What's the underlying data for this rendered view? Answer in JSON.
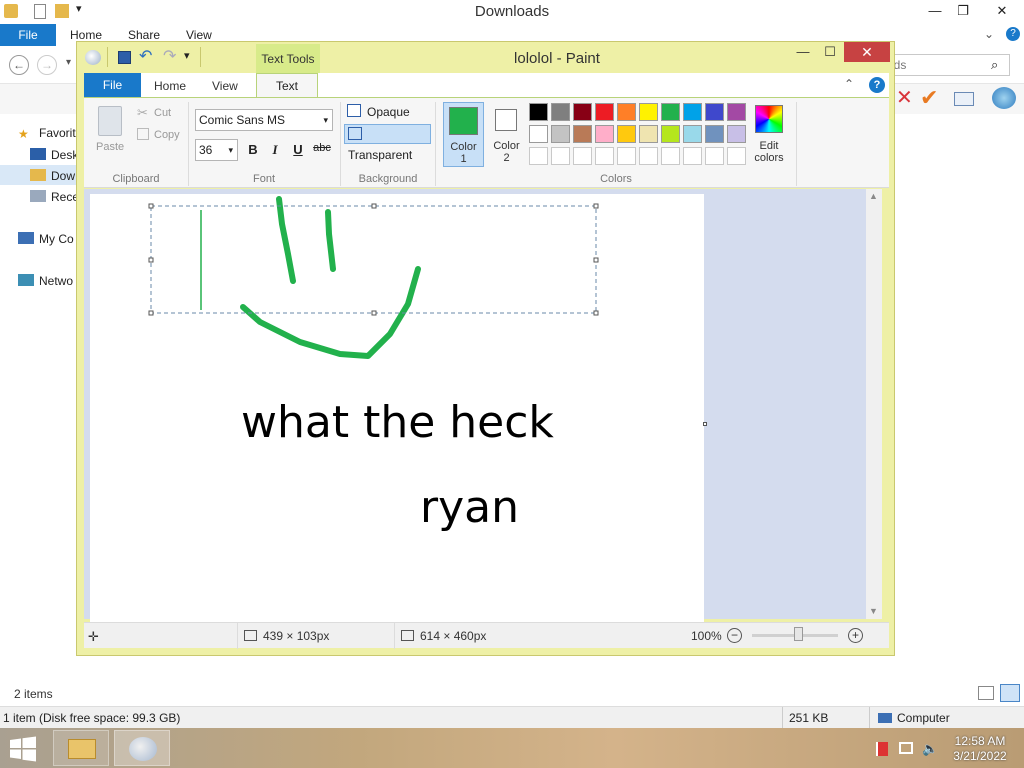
{
  "explorer": {
    "title": "Downloads",
    "tabs": [
      "File",
      "Home",
      "Share",
      "View"
    ],
    "search_placeholder": "Search Downloads",
    "search_visible": "ads",
    "sidebar": [
      "Favorites",
      "Desktop",
      "Downloads",
      "Recent places",
      "My Computer",
      "Network"
    ],
    "sidebar_visible": [
      "Favorit",
      "Desk",
      "Dow",
      "Rece",
      "My Co",
      "Netwo"
    ],
    "items_count": "2 items",
    "status_left": "1 item (Disk free space: 99.3 GB)",
    "status_size": "251 KB",
    "status_location": "Computer"
  },
  "paint": {
    "title": "lololol - Paint",
    "context_tab_group": "Text Tools",
    "tabs": {
      "file": "File",
      "home": "Home",
      "view": "View",
      "text": "Text"
    },
    "clipboard": {
      "paste": "Paste",
      "cut": "Cut",
      "copy": "Copy",
      "label": "Clipboard"
    },
    "font": {
      "name": "Comic Sans MS",
      "size": "36",
      "bold": "B",
      "italic": "I",
      "underline": "U",
      "strike": "abc",
      "label": "Font"
    },
    "background": {
      "opaque": "Opaque",
      "transparent": "Transparent",
      "label": "Background"
    },
    "colors": {
      "color1_label": "Color",
      "color1_num": "1",
      "color2_label": "Color",
      "color2_num": "2",
      "edit_label": "Edit",
      "edit_label2": "colors",
      "label": "Colors",
      "color1": "#22b14c",
      "color2": "#ffffff",
      "row1": [
        "#000000",
        "#7f7f7f",
        "#880015",
        "#ed1c24",
        "#ff7f27",
        "#fff200",
        "#22b14c",
        "#00a2e8",
        "#3f48cc",
        "#a349a4"
      ],
      "row2": [
        "#ffffff",
        "#c3c3c3",
        "#b97a57",
        "#ffaec9",
        "#ffc90e",
        "#efe4b0",
        "#b5e61d",
        "#99d9ea",
        "#7092be",
        "#c8bfe7"
      ]
    },
    "canvas": {
      "text1": "what the heck",
      "text2": "ryan",
      "stroke_color": "#22b14c"
    },
    "status": {
      "selection_size": "439 × 103px",
      "canvas_size": "614 × 460px",
      "zoom": "100%"
    }
  },
  "taskbar": {
    "time": "12:58 AM",
    "date": "3/21/2022"
  }
}
